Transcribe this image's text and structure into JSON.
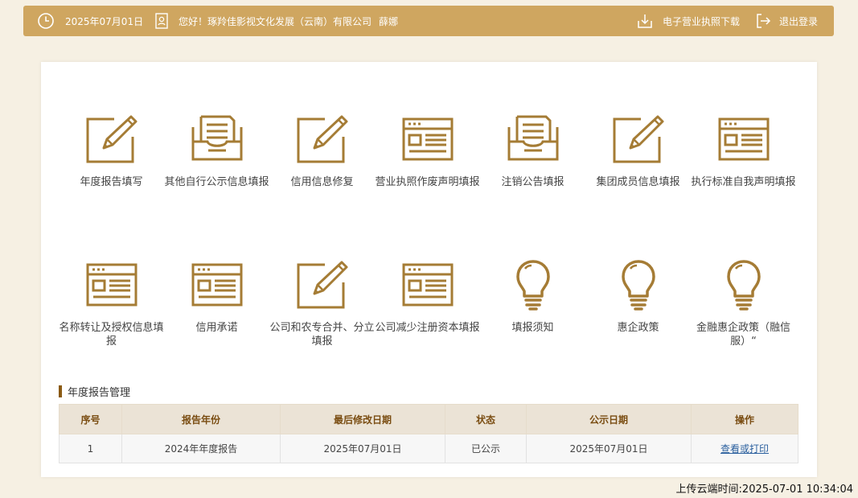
{
  "topbar": {
    "date": "2025年07月01日",
    "greeting": "您好！琢羚佳影视文化发展（云南）有限公司",
    "user_name": "薛娜",
    "license_download": "电子营业执照下载",
    "logout": "退出登录"
  },
  "colors": {
    "brand": "#cfa660",
    "icon": "#a57c35",
    "section_bar": "#8a5a13",
    "link": "#2a5f9e"
  },
  "tiles": [
    {
      "label": "年度报告填写",
      "icon": "edit-pen-icon"
    },
    {
      "label": "其他自行公示信息填报",
      "icon": "document-tray-icon"
    },
    {
      "label": "信用信息修复",
      "icon": "edit-pen-icon"
    },
    {
      "label": "营业执照作废声明填报",
      "icon": "form-window-icon"
    },
    {
      "label": "注销公告填报",
      "icon": "document-tray-icon"
    },
    {
      "label": "集团成员信息填报",
      "icon": "edit-pen-icon"
    },
    {
      "label": "执行标准自我声明填报",
      "icon": "form-window-icon"
    },
    {
      "label": "名称转让及授权信息填报",
      "icon": "form-window-icon"
    },
    {
      "label": "信用承诺",
      "icon": "form-window-icon"
    },
    {
      "label": "公司和农专合并、分立填报",
      "icon": "edit-pen-icon"
    },
    {
      "label": "公司减少注册资本填报",
      "icon": "form-window-icon"
    },
    {
      "label": "填报须知",
      "icon": "lightbulb-icon"
    },
    {
      "label": "惠企政策",
      "icon": "lightbulb-icon"
    },
    {
      "label": "金融惠企政策（融信服）“",
      "icon": "lightbulb-icon"
    }
  ],
  "annual_report": {
    "title": "年度报告管理",
    "columns": [
      "序号",
      "报告年份",
      "最后修改日期",
      "状态",
      "公示日期",
      "操作"
    ],
    "rows": [
      {
        "index": "1",
        "year": "2024年年度报告",
        "modified": "2025年07月01日",
        "status": "已公示",
        "published": "2025年07月01日",
        "action": "查看或打印"
      }
    ]
  },
  "upload_time": "上传云端时间:2025-07-01 10:34:04"
}
